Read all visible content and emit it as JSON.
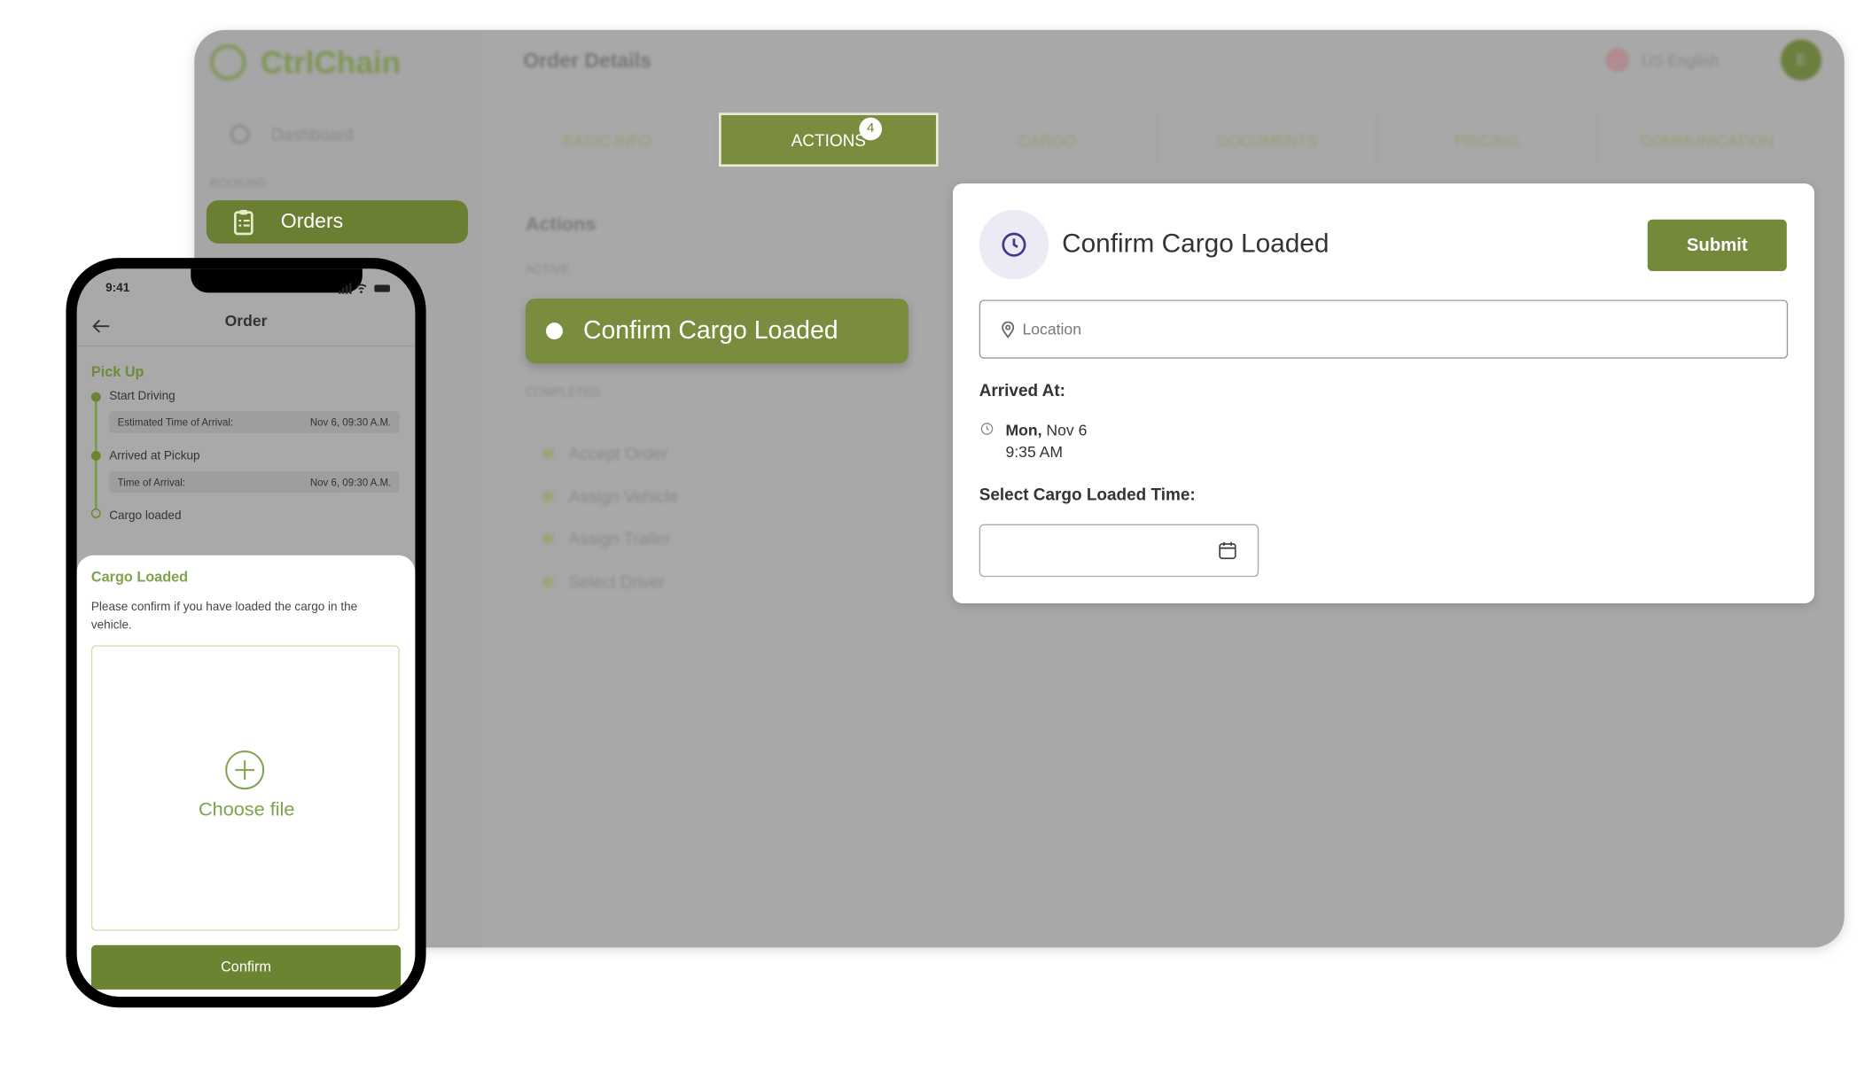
{
  "app": {
    "logo": "CtrlChain",
    "page_title": "Order Details",
    "language": "US English",
    "avatar_initial": "E"
  },
  "sidebar": {
    "dashboard": "Dashboard",
    "section": "BOOKING",
    "orders": "Orders"
  },
  "tabs": [
    {
      "label": "BASIC INFO"
    },
    {
      "label": "ACTIONS",
      "badge": "4"
    },
    {
      "label": "CARGO"
    },
    {
      "label": "DOCUMENTS"
    },
    {
      "label": "PRICING"
    },
    {
      "label": "COMMUNICATION"
    }
  ],
  "actions": {
    "title": "Actions",
    "active_label": "ACTIVE",
    "active_item": "Confirm Cargo Loaded",
    "completed_label": "COMPLETED",
    "completed": [
      "Accept Order",
      "Assign Vehicle",
      "Assign Trailer",
      "Select Driver"
    ]
  },
  "card": {
    "title": "Confirm Cargo Loaded",
    "submit": "Submit",
    "location_placeholder": "Location",
    "arrived_label": "Arrived At:",
    "arrived_day": "Mon,",
    "arrived_date": " Nov 6",
    "arrived_time": "9:35 AM",
    "select_label": "Select Cargo Loaded Time:",
    "time_value": ""
  },
  "phone": {
    "time": "9:41",
    "title": "Order",
    "section": "Pick Up",
    "steps": [
      {
        "label": "Start Driving",
        "info_label": "Estimated Time of Arrival:",
        "info_value": "Nov 6, 09:30 A.M."
      },
      {
        "label": "Arrived at Pickup",
        "info_label": "Time of Arrival:",
        "info_value": "Nov 6, 09:30 A.M."
      },
      {
        "label": "Cargo loaded"
      }
    ],
    "sheet": {
      "title": "Cargo Loaded",
      "text": "Please confirm if you have loaded the cargo in the vehicle.",
      "upload": "Choose file",
      "confirm": "Confirm"
    }
  },
  "colors": {
    "brand": "#748a3a",
    "accent_light": "#7fa24a"
  }
}
